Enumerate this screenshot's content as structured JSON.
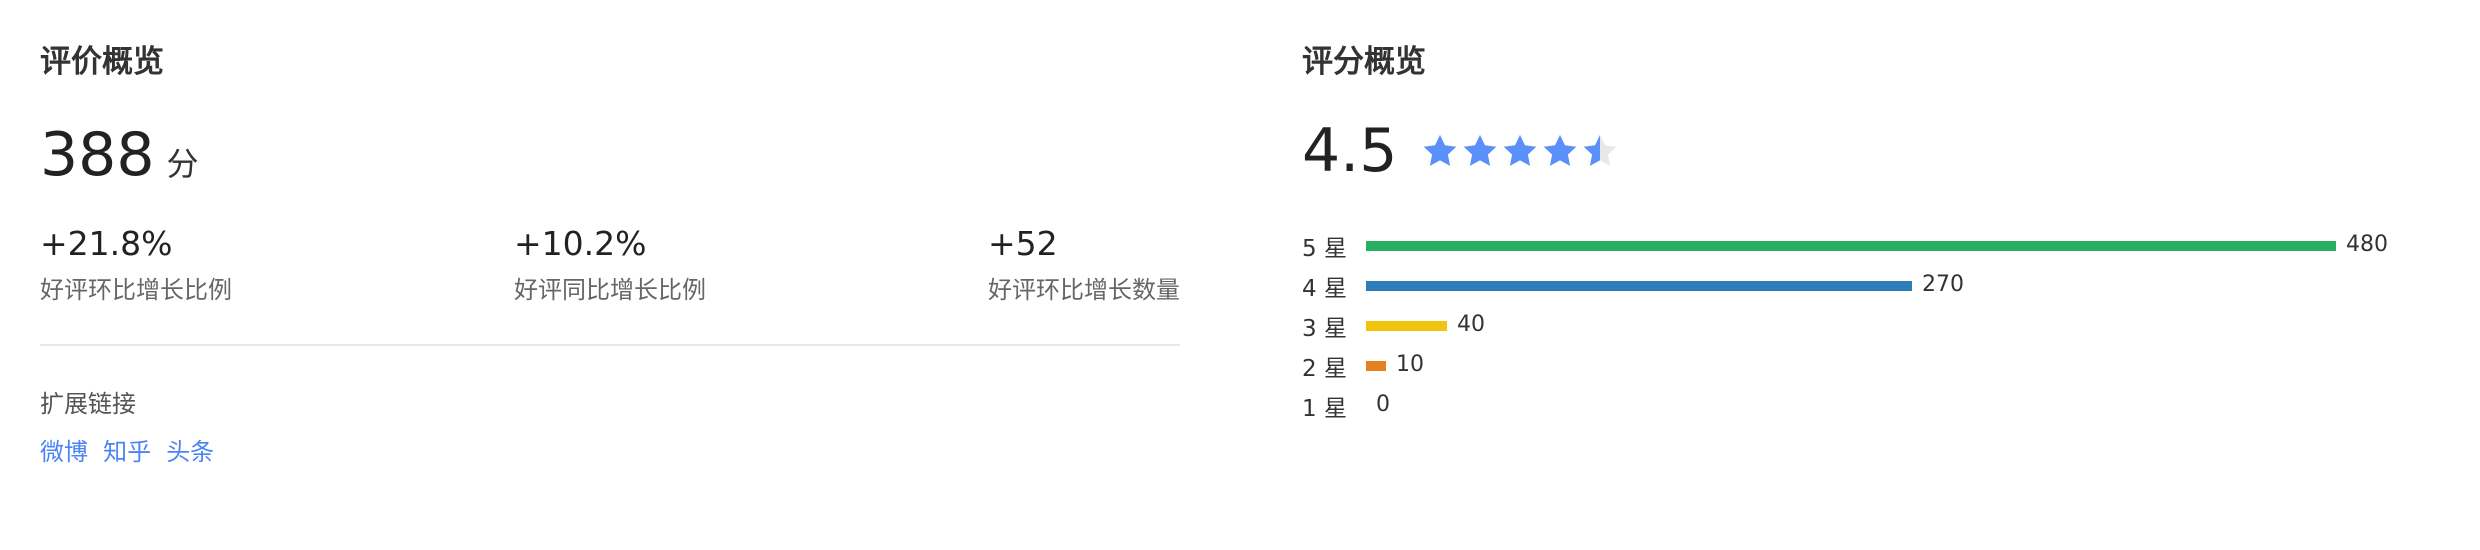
{
  "review_overview": {
    "title": "评价概览",
    "score_value": "388",
    "score_unit": "分",
    "metrics": [
      {
        "value": "+21.8%",
        "label": "好评环比增长比例"
      },
      {
        "value": "+10.2%",
        "label": "好评同比增长比例"
      },
      {
        "value": "+52",
        "label": "好评环比增长数量"
      }
    ],
    "links_heading": "扩展链接",
    "links": [
      "微博",
      "知乎",
      "头条"
    ]
  },
  "rating_overview": {
    "title": "评分概览",
    "rating_value": "4.5",
    "stars": {
      "rating": 4.5,
      "max": 5,
      "filled_color": "#5b8ff9",
      "empty_color": "#e8e8e8"
    },
    "bars": [
      {
        "label": "5 星",
        "count": 480,
        "count_text": "480",
        "color": "#27ae60"
      },
      {
        "label": "4 星",
        "count": 270,
        "count_text": "270",
        "color": "#2d7db8"
      },
      {
        "label": "3 星",
        "count": 40,
        "count_text": "40",
        "color": "#f1c40f"
      },
      {
        "label": "2 星",
        "count": 10,
        "count_text": "10",
        "color": "#e67e22"
      },
      {
        "label": "1 星",
        "count": 0,
        "count_text": "0",
        "color": "#cccccc"
      }
    ],
    "max_count": 480
  }
}
